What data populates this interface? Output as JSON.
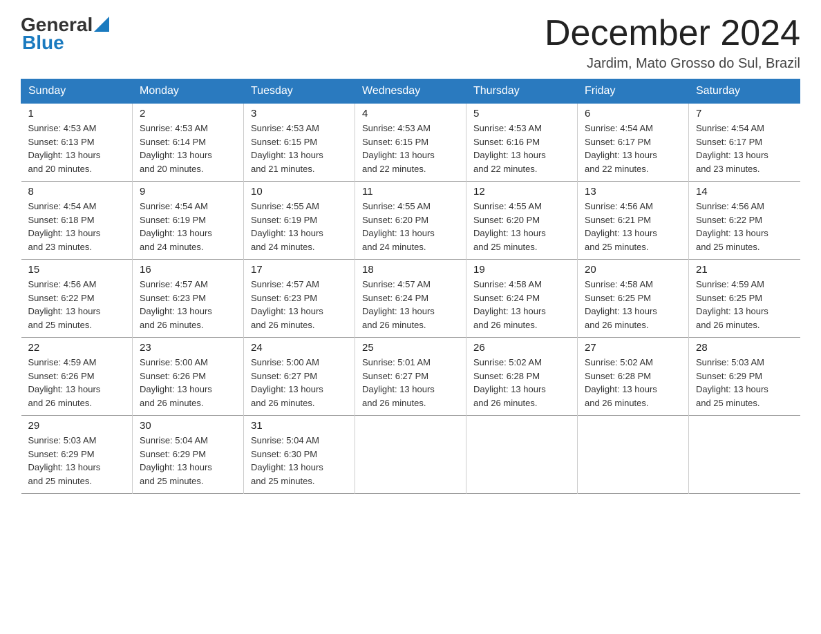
{
  "header": {
    "logo_general": "General",
    "logo_blue": "Blue",
    "month_title": "December 2024",
    "location": "Jardim, Mato Grosso do Sul, Brazil"
  },
  "days_of_week": [
    "Sunday",
    "Monday",
    "Tuesday",
    "Wednesday",
    "Thursday",
    "Friday",
    "Saturday"
  ],
  "weeks": [
    [
      {
        "day": "1",
        "sunrise": "4:53 AM",
        "sunset": "6:13 PM",
        "daylight": "13 hours and 20 minutes."
      },
      {
        "day": "2",
        "sunrise": "4:53 AM",
        "sunset": "6:14 PM",
        "daylight": "13 hours and 20 minutes."
      },
      {
        "day": "3",
        "sunrise": "4:53 AM",
        "sunset": "6:15 PM",
        "daylight": "13 hours and 21 minutes."
      },
      {
        "day": "4",
        "sunrise": "4:53 AM",
        "sunset": "6:15 PM",
        "daylight": "13 hours and 22 minutes."
      },
      {
        "day": "5",
        "sunrise": "4:53 AM",
        "sunset": "6:16 PM",
        "daylight": "13 hours and 22 minutes."
      },
      {
        "day": "6",
        "sunrise": "4:54 AM",
        "sunset": "6:17 PM",
        "daylight": "13 hours and 22 minutes."
      },
      {
        "day": "7",
        "sunrise": "4:54 AM",
        "sunset": "6:17 PM",
        "daylight": "13 hours and 23 minutes."
      }
    ],
    [
      {
        "day": "8",
        "sunrise": "4:54 AM",
        "sunset": "6:18 PM",
        "daylight": "13 hours and 23 minutes."
      },
      {
        "day": "9",
        "sunrise": "4:54 AM",
        "sunset": "6:19 PM",
        "daylight": "13 hours and 24 minutes."
      },
      {
        "day": "10",
        "sunrise": "4:55 AM",
        "sunset": "6:19 PM",
        "daylight": "13 hours and 24 minutes."
      },
      {
        "day": "11",
        "sunrise": "4:55 AM",
        "sunset": "6:20 PM",
        "daylight": "13 hours and 24 minutes."
      },
      {
        "day": "12",
        "sunrise": "4:55 AM",
        "sunset": "6:20 PM",
        "daylight": "13 hours and 25 minutes."
      },
      {
        "day": "13",
        "sunrise": "4:56 AM",
        "sunset": "6:21 PM",
        "daylight": "13 hours and 25 minutes."
      },
      {
        "day": "14",
        "sunrise": "4:56 AM",
        "sunset": "6:22 PM",
        "daylight": "13 hours and 25 minutes."
      }
    ],
    [
      {
        "day": "15",
        "sunrise": "4:56 AM",
        "sunset": "6:22 PM",
        "daylight": "13 hours and 25 minutes."
      },
      {
        "day": "16",
        "sunrise": "4:57 AM",
        "sunset": "6:23 PM",
        "daylight": "13 hours and 26 minutes."
      },
      {
        "day": "17",
        "sunrise": "4:57 AM",
        "sunset": "6:23 PM",
        "daylight": "13 hours and 26 minutes."
      },
      {
        "day": "18",
        "sunrise": "4:57 AM",
        "sunset": "6:24 PM",
        "daylight": "13 hours and 26 minutes."
      },
      {
        "day": "19",
        "sunrise": "4:58 AM",
        "sunset": "6:24 PM",
        "daylight": "13 hours and 26 minutes."
      },
      {
        "day": "20",
        "sunrise": "4:58 AM",
        "sunset": "6:25 PM",
        "daylight": "13 hours and 26 minutes."
      },
      {
        "day": "21",
        "sunrise": "4:59 AM",
        "sunset": "6:25 PM",
        "daylight": "13 hours and 26 minutes."
      }
    ],
    [
      {
        "day": "22",
        "sunrise": "4:59 AM",
        "sunset": "6:26 PM",
        "daylight": "13 hours and 26 minutes."
      },
      {
        "day": "23",
        "sunrise": "5:00 AM",
        "sunset": "6:26 PM",
        "daylight": "13 hours and 26 minutes."
      },
      {
        "day": "24",
        "sunrise": "5:00 AM",
        "sunset": "6:27 PM",
        "daylight": "13 hours and 26 minutes."
      },
      {
        "day": "25",
        "sunrise": "5:01 AM",
        "sunset": "6:27 PM",
        "daylight": "13 hours and 26 minutes."
      },
      {
        "day": "26",
        "sunrise": "5:02 AM",
        "sunset": "6:28 PM",
        "daylight": "13 hours and 26 minutes."
      },
      {
        "day": "27",
        "sunrise": "5:02 AM",
        "sunset": "6:28 PM",
        "daylight": "13 hours and 26 minutes."
      },
      {
        "day": "28",
        "sunrise": "5:03 AM",
        "sunset": "6:29 PM",
        "daylight": "13 hours and 25 minutes."
      }
    ],
    [
      {
        "day": "29",
        "sunrise": "5:03 AM",
        "sunset": "6:29 PM",
        "daylight": "13 hours and 25 minutes."
      },
      {
        "day": "30",
        "sunrise": "5:04 AM",
        "sunset": "6:29 PM",
        "daylight": "13 hours and 25 minutes."
      },
      {
        "day": "31",
        "sunrise": "5:04 AM",
        "sunset": "6:30 PM",
        "daylight": "13 hours and 25 minutes."
      },
      null,
      null,
      null,
      null
    ]
  ],
  "labels": {
    "sunrise": "Sunrise:",
    "sunset": "Sunset:",
    "daylight": "Daylight:"
  }
}
